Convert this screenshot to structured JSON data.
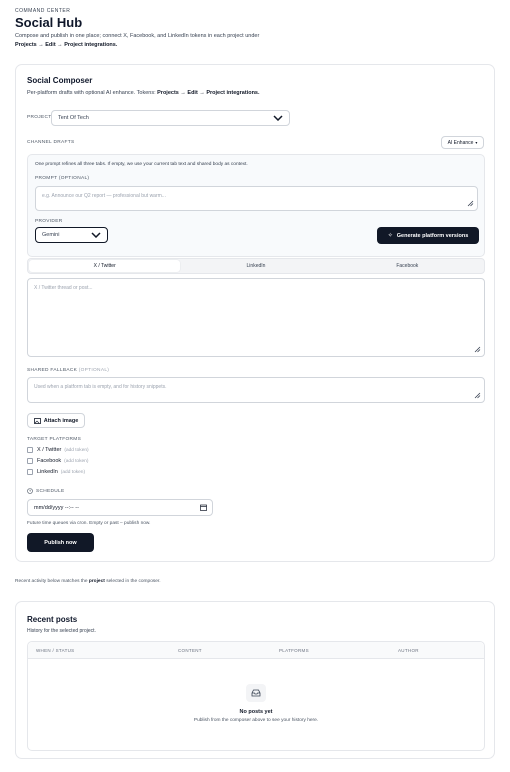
{
  "header": {
    "eyebrow": "COMMAND CENTER",
    "title": "Social Hub",
    "subtitle_line1": "Compose and publish in one place; connect X, Facebook, and LinkedIn tokens in each project under",
    "subtitle_line2": "Projects → Edit → Project integrations."
  },
  "composer": {
    "title": "Social Composer",
    "subtitle_prefix": "Per-platform drafts with optional AI enhance. Tokens: ",
    "subtitle_path": "Projects → Edit → Project integrations.",
    "project_label": "PROJECT",
    "project_value": "Tent Of Tech",
    "channel_drafts_label": "CHANNEL DRAFTS",
    "ai_enhance_label": "AI Enhance",
    "ai_panel": {
      "note": "One prompt refines all three tabs. If empty, we use your current tab text and shared body as context.",
      "prompt_label": "PROMPT",
      "prompt_optional": "(OPTIONAL)",
      "prompt_placeholder": "e.g. Announce our Q2 report — professional but warm...",
      "provider_label": "PROVIDER",
      "provider_value": "Gemini",
      "generate_label": "Generate platform versions"
    },
    "tabs": [
      {
        "label": "X / Twitter",
        "active": true
      },
      {
        "label": "LinkedIn",
        "active": false
      },
      {
        "label": "Facebook",
        "active": false
      }
    ],
    "draft_placeholder": "X / Twitter thread or post...",
    "shared_fallback_label": "SHARED FALLBACK",
    "shared_fallback_optional": "(OPTIONAL)",
    "shared_fallback_placeholder": "Used when a platform tab is empty, and for history snippets.",
    "attach_image_label": "Attach image",
    "target_platforms_label": "TARGET PLATFORMS",
    "platforms": [
      {
        "name": "X / Twitter",
        "hint": "(add token)"
      },
      {
        "name": "Facebook",
        "hint": "(add token)"
      },
      {
        "name": "LinkedIn",
        "hint": "(add token)"
      }
    ],
    "schedule_label": "SCHEDULE",
    "schedule_value": "mm/dd/yyyy --:-- --",
    "schedule_help": "Future time queues via cron. Empty or past – publish now.",
    "publish_label": "Publish now"
  },
  "activity_note_prefix": "Recent activity below matches the ",
  "activity_note_bold": "project",
  "activity_note_suffix": " selected in the composer.",
  "recent": {
    "title": "Recent posts",
    "subtitle": "History for the selected project.",
    "columns": [
      "WHEN / STATUS",
      "CONTENT",
      "PLATFORMS",
      "AUTHOR"
    ],
    "empty_title": "No posts yet",
    "empty_sub": "Publish from the composer above to see your history here."
  }
}
